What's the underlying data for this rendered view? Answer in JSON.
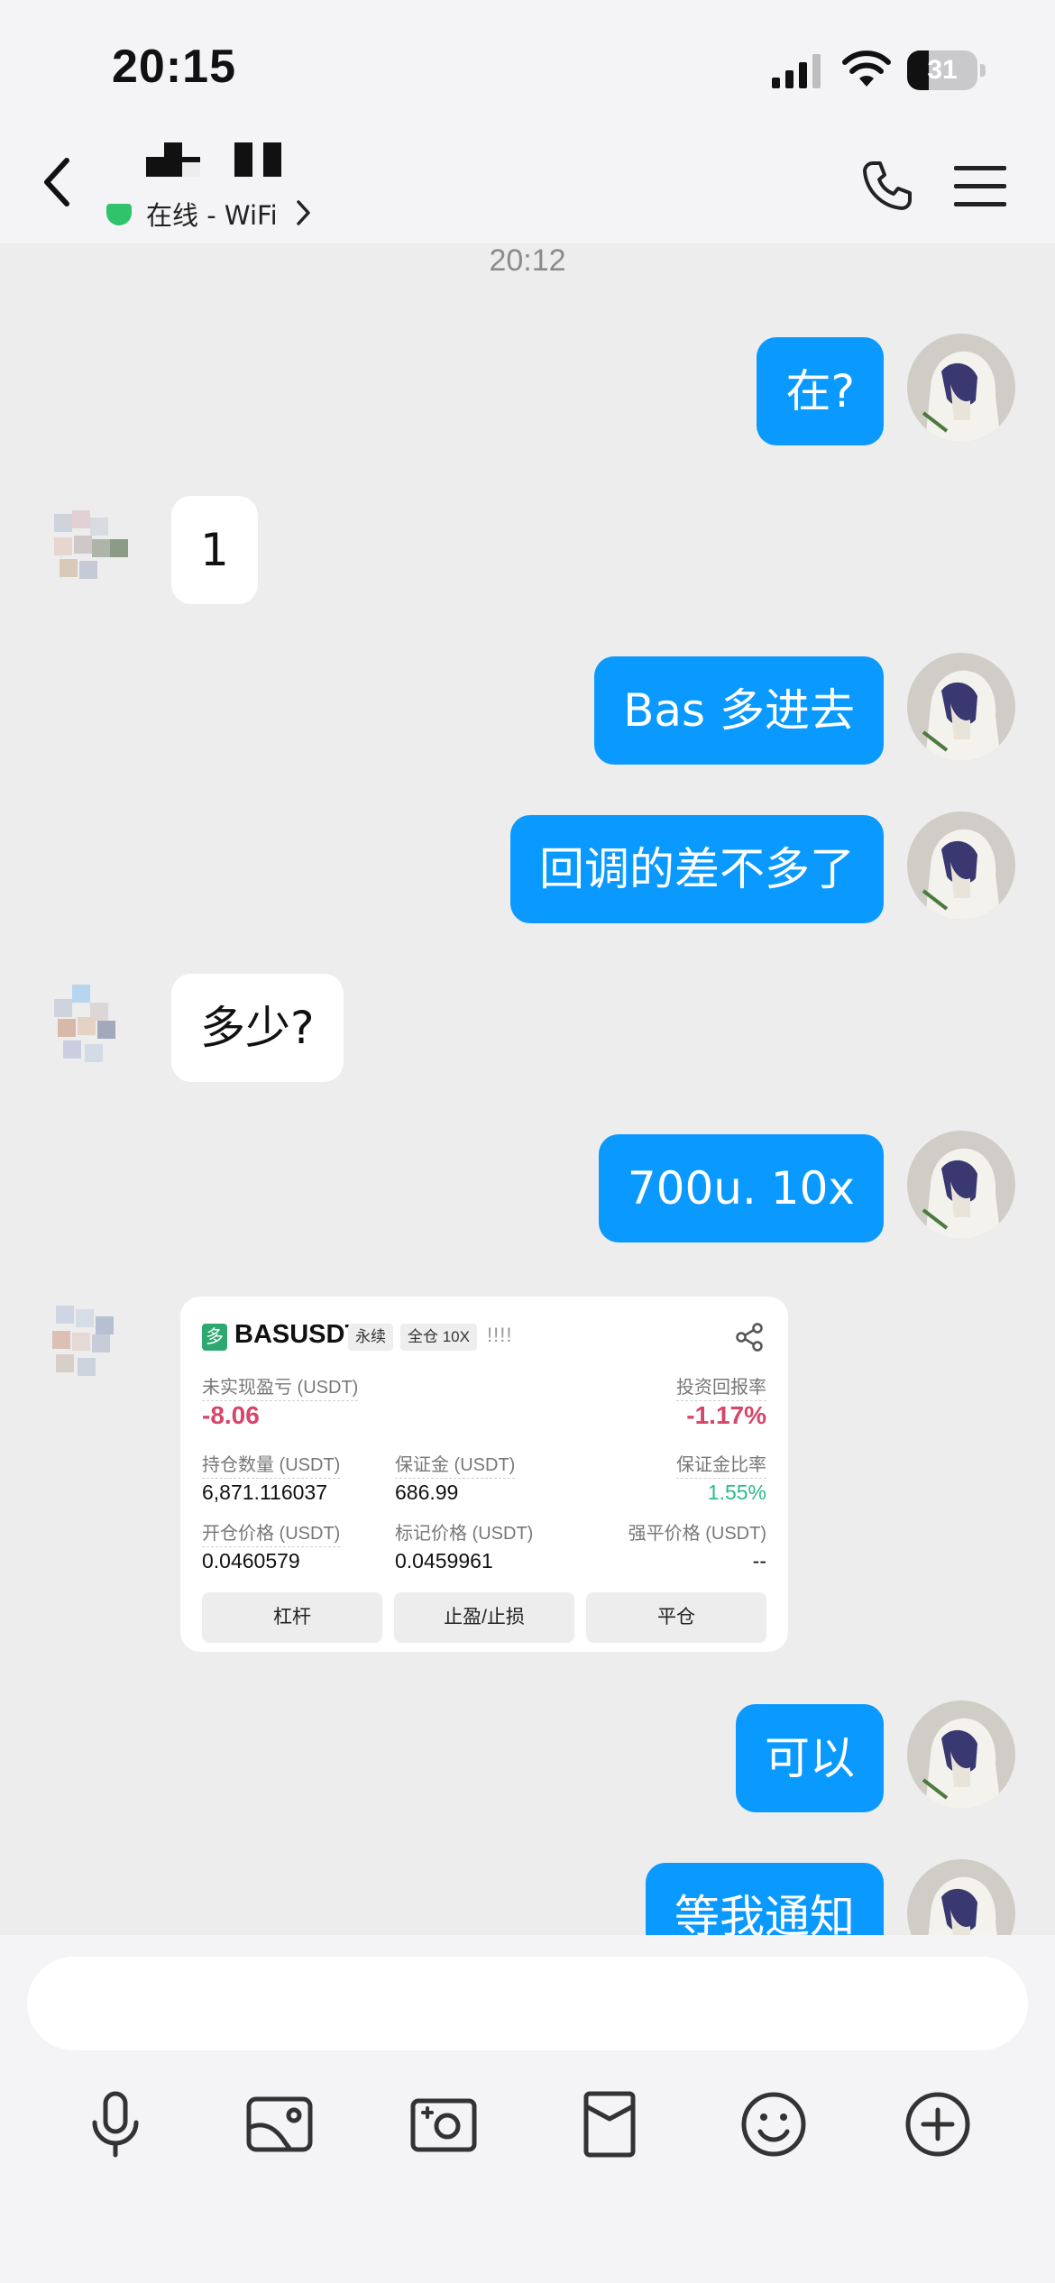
{
  "status_bar": {
    "time": "20:15",
    "battery": "31",
    "battery_level": 0.31
  },
  "header": {
    "status_text": "在线 - WiFi"
  },
  "chat": {
    "timestamp": "20:12",
    "messages": [
      {
        "side": "out",
        "text": "在?"
      },
      {
        "side": "in",
        "text": "1"
      },
      {
        "side": "out",
        "text": "Bas 多进去"
      },
      {
        "side": "out",
        "text": "回调的差不多了"
      },
      {
        "side": "in",
        "text": "多少?"
      },
      {
        "side": "out",
        "text": "700u.   10x"
      },
      {
        "side": "out",
        "text": "可以"
      },
      {
        "side": "out",
        "text": "等我通知"
      }
    ],
    "trade_card": {
      "badge": "多",
      "symbol": "BASUSDT",
      "type_tag": "永续",
      "margin_tag": "全仓 10X",
      "signal": "!!!!",
      "unrealized_pnl_label": "未实现盈亏 (USDT)",
      "unrealized_pnl": "-8.06",
      "roi_label": "投资回报率",
      "roi": "-1.17%",
      "position_size_label": "持仓数量 (USDT)",
      "position_size": "6,871.116037",
      "margin_label": "保证金 (USDT)",
      "margin": "686.99",
      "margin_ratio_label": "保证金比率",
      "margin_ratio": "1.55%",
      "entry_price_label": "开仓价格 (USDT)",
      "entry_price": "0.0460579",
      "mark_price_label": "标记价格 (USDT)",
      "mark_price": "0.0459961",
      "liq_price_label": "强平价格 (USDT)",
      "liq_price": "--",
      "buttons": [
        "杠杆",
        "止盈/止损",
        "平仓"
      ]
    }
  },
  "input": {
    "placeholder": ""
  },
  "toolbar": [
    "microphone-icon",
    "image-icon",
    "camera-icon",
    "red-packet-icon",
    "emoji-icon",
    "plus-icon"
  ],
  "colors": {
    "outgoing_bubble": "#0a9aff",
    "online": "#2fc36b",
    "loss": "#d6456a",
    "gain": "#2aba8c"
  }
}
